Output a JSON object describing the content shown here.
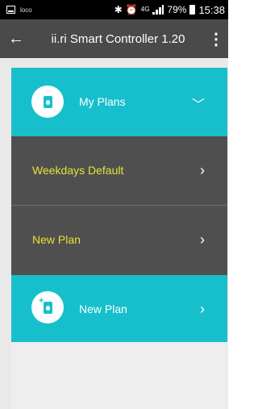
{
  "status_bar": {
    "app_name": "loco",
    "network": "4G",
    "battery": "79%",
    "time": "15:38"
  },
  "app_bar": {
    "title": "ii.ri Smart Controller 1.20"
  },
  "plans": {
    "header_label": "My Plans",
    "items": [
      {
        "label": "Weekdays Default"
      },
      {
        "label": "New Plan"
      }
    ],
    "add_label": "New Plan"
  },
  "colors": {
    "accent": "#17bfcc",
    "row_bg": "#4f4f4f",
    "row_text": "#e6e23a",
    "app_bar": "#4a4a4a"
  }
}
